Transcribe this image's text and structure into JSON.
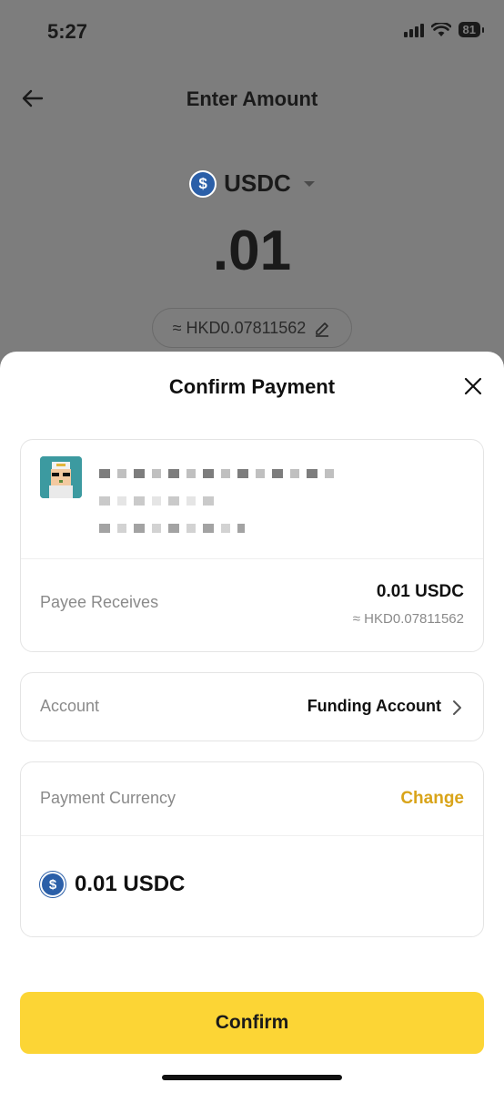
{
  "status": {
    "time": "5:27",
    "battery": "81"
  },
  "nav": {
    "title": "Enter Amount"
  },
  "amount_screen": {
    "asset": "USDC",
    "amount": ".01",
    "fx_estimate": "≈ HKD0.07811562"
  },
  "sheet": {
    "title": "Confirm Payment",
    "payee_receives": {
      "label": "Payee Receives",
      "value": "0.01 USDC",
      "fx": "≈ HKD0.07811562"
    },
    "account": {
      "label": "Account",
      "value": "Funding Account"
    },
    "payment_currency": {
      "label": "Payment Currency",
      "change_label": "Change",
      "amount": "0.01 USDC"
    },
    "confirm_label": "Confirm"
  },
  "colors": {
    "accent_yellow": "#fcd535",
    "change_link": "#d9a41a",
    "usdc_blue": "#2b5fa8"
  },
  "icons": [
    "back-arrow-icon",
    "usdc-icon",
    "caret-down-icon",
    "edit-pencil-icon",
    "close-icon",
    "chevron-right-icon",
    "avatar-icon"
  ]
}
